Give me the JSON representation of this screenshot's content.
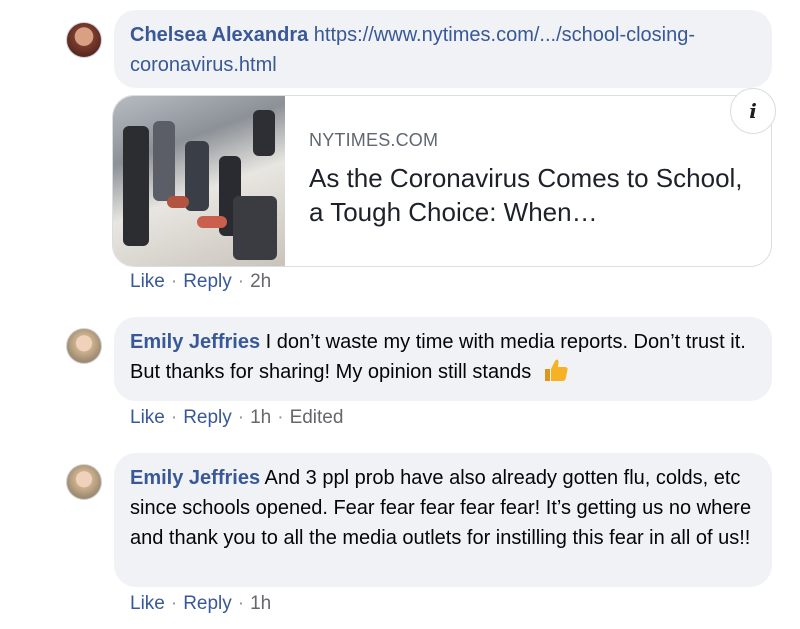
{
  "comments": [
    {
      "author": "Chelsea Alexandra",
      "text": "https://www.nytimes.com/.../school-closing-coronavirus.html",
      "link_preview": {
        "domain": "NYTIMES.COM",
        "headline": "As the Coronavirus Comes to School, a Tough Choice: When…",
        "info_icon": "info-icon"
      },
      "actions": {
        "like": "Like",
        "reply": "Reply",
        "time": "2h"
      }
    },
    {
      "author": "Emily Jeffries",
      "text": "I don’t waste my time with media reports. Don’t trust it. But thanks for sharing! My opinion still stands",
      "emoji": "thumbs-up-icon",
      "actions": {
        "like": "Like",
        "reply": "Reply",
        "time": "1h",
        "edited": "Edited"
      }
    },
    {
      "author": "Emily Jeffries",
      "text": "And 3 ppl prob have also already gotten flu, colds, etc since schools opened. Fear fear fear fear fear! It’s getting us no where and thank you to all the media outlets for instilling this fear in all of us!!",
      "actions": {
        "like": "Like",
        "reply": "Reply",
        "time": "1h"
      }
    }
  ],
  "colors": {
    "bubble": "#f0f2f5",
    "author": "#385898",
    "meta": "#65676b",
    "emoji": "#f7b125"
  }
}
